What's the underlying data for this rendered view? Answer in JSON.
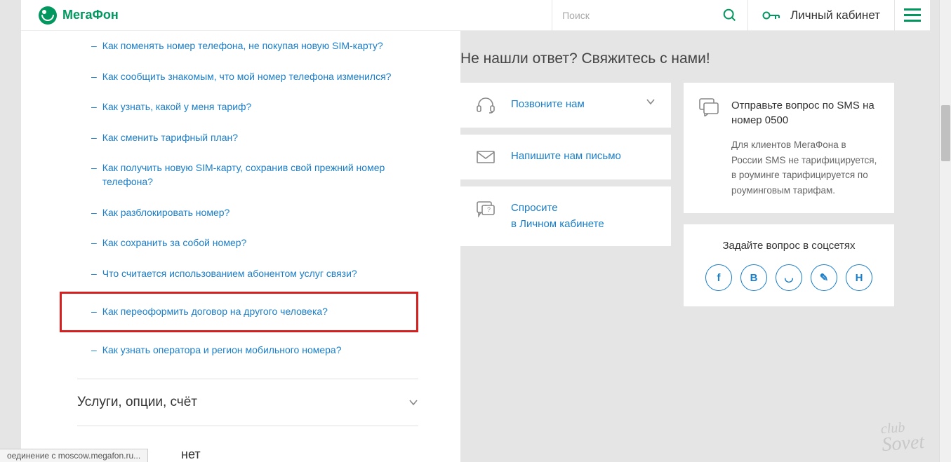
{
  "header": {
    "logo_text": "МегаФон",
    "search_placeholder": "Поиск",
    "account_label": "Личный кабинет"
  },
  "faq": {
    "items": [
      "Как поменять номер телефона, не покупая новую SIM-карту?",
      "Как сообщить знакомым, что мой номер телефона изменился?",
      "Как узнать, какой у меня тариф?",
      "Как сменить тарифный план?",
      "Как получить новую SIM-карту, сохранив свой прежний номер телефона?",
      "Как разблокировать номер?",
      "Как сохранить за собой номер?",
      "Что считается использованием абонентом услуг связи?",
      "Как переоформить договор на другого человека?",
      "Как узнать оператора и регион мобильного номера?"
    ],
    "highlighted_index": 8
  },
  "accordion": {
    "section_label": "Услуги, опции, счёт",
    "cut_label": "нет"
  },
  "contact": {
    "heading": "Не нашли ответ? Свяжитесь с нами!",
    "call": "Позвоните нам",
    "write": "Напишите нам письмо",
    "ask_line1": "Спросите",
    "ask_line2": "в Личном кабинете"
  },
  "sms": {
    "title": "Отправьте вопрос по SMS на номер 0500",
    "desc": "Для клиентов МегаФона в России SMS не тарифицируется,\nв роуминге тарифицируется по роуминговым тарифам."
  },
  "social": {
    "title": "Задайте вопрос в соцсетях",
    "buttons": [
      "f",
      "В",
      "◡",
      "✎",
      "Н"
    ]
  },
  "status": {
    "text": "оединение с moscow.megafon.ru..."
  },
  "watermark": {
    "line1": "club",
    "line2": "Sovet"
  }
}
